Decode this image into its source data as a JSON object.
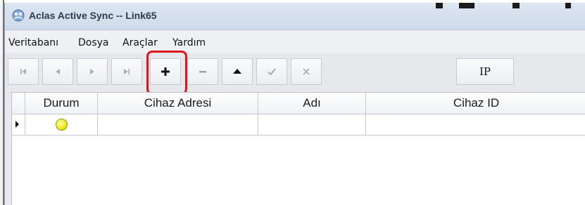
{
  "window": {
    "title": "Aclas Active Sync -- Link65"
  },
  "menu": {
    "items": [
      "Veritabanı",
      "Dosya",
      "Araçlar",
      "Yardım"
    ]
  },
  "toolbar": {
    "buttons": [
      {
        "name": "first-record",
        "icon": "skip-first-icon",
        "enabled": false
      },
      {
        "name": "prior-record",
        "icon": "prev-icon",
        "enabled": false
      },
      {
        "name": "next-record",
        "icon": "next-icon",
        "enabled": false
      },
      {
        "name": "last-record",
        "icon": "skip-last-icon",
        "enabled": false
      },
      {
        "name": "insert-record",
        "icon": "plus-icon",
        "enabled": true
      },
      {
        "name": "delete-record",
        "icon": "minus-icon",
        "enabled": false
      },
      {
        "name": "edit-record",
        "icon": "triangle-up-icon",
        "enabled": true
      },
      {
        "name": "post-edit",
        "icon": "check-icon",
        "enabled": false
      },
      {
        "name": "cancel-edit",
        "icon": "x-icon",
        "enabled": false
      }
    ],
    "ip_label": "IP",
    "highlight_color": "#e0151b"
  },
  "grid": {
    "columns": [
      "Durum",
      "Cihaz Adresi",
      "Adı",
      "Cihaz ID"
    ],
    "rows": [
      {
        "status": "yellow",
        "cihaz_adresi": "",
        "adi": "",
        "cihaz_id": ""
      }
    ]
  }
}
